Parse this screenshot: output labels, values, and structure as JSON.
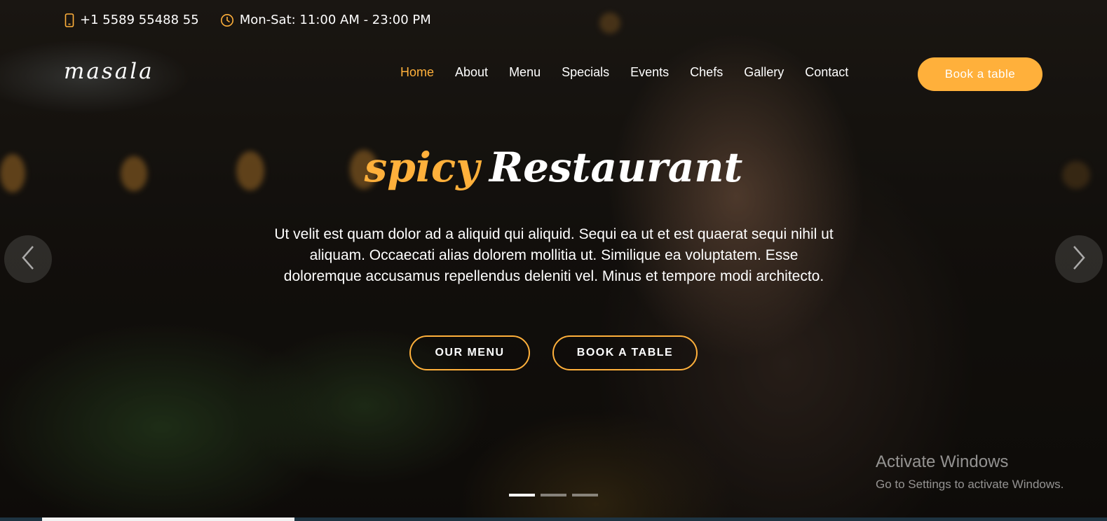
{
  "topbar": {
    "phone": "+1 5589 55488 55",
    "hours": "Mon-Sat: 11:00 AM - 23:00 PM"
  },
  "logo": "masala",
  "nav": {
    "items": [
      "Home",
      "About",
      "Menu",
      "Specials",
      "Events",
      "Chefs",
      "Gallery",
      "Contact"
    ],
    "active": "Home",
    "book_label": "Book a table"
  },
  "hero": {
    "title_accent": "spicy",
    "title_main": "Restaurant",
    "description": "Ut velit est quam dolor ad a aliquid qui aliquid. Sequi ea ut et est quaerat sequi nihil ut aliquam. Occaecati alias dolorem mollitia ut. Similique ea voluptatem. Esse doloremque accusamus repellendus deleniti vel. Minus et tempore modi architecto.",
    "btn_menu": "OUR MENU",
    "btn_book": "BOOK A TABLE"
  },
  "carousel": {
    "slide_count": 3,
    "active_index": 0
  },
  "watermark": {
    "title": "Activate Windows",
    "subtitle": "Go to Settings to activate Windows."
  },
  "colors": {
    "accent": "#ffb03b",
    "text": "#ffffff"
  }
}
